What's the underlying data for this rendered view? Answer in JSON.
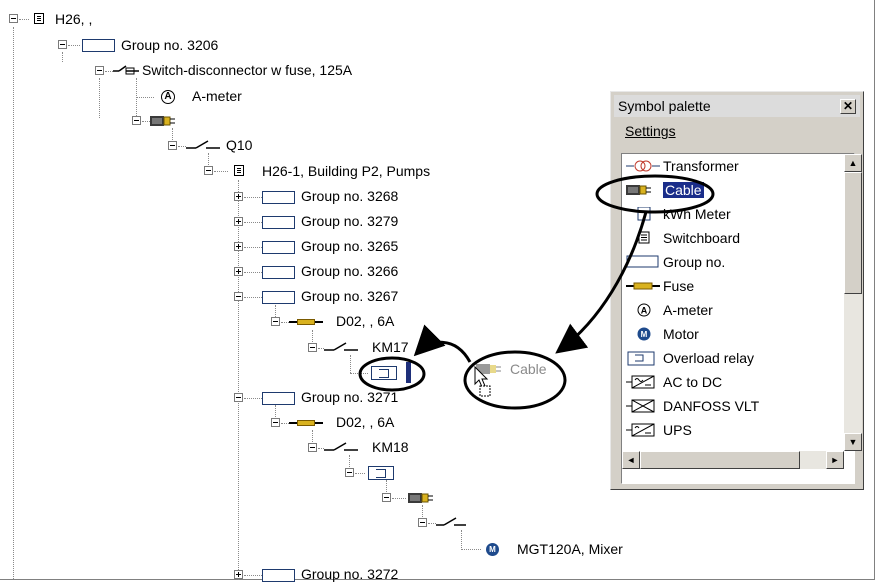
{
  "tree": {
    "root": "H26, ,",
    "group_3206": "Group no. 3206",
    "switch_disconnector": "Switch-disconnector w fuse, 125A",
    "a_meter": "A-meter",
    "q10": "Q10",
    "board_h26_1": "H26-1, Building P2, Pumps",
    "groups_top": [
      "Group no. 3268",
      "Group no. 3279",
      "Group no. 3265",
      "Group no. 3266",
      "Group no. 3267"
    ],
    "d02_a": "D02, , 6A",
    "km17": "KM17",
    "group_3271": "Group no. 3271",
    "d02_b": "D02, , 6A",
    "km18": "KM18",
    "mixer": "MGT120A, Mixer",
    "group_3272": "Group no. 3272"
  },
  "drag": {
    "ghost_label": "Cable"
  },
  "palette": {
    "title": "Symbol palette",
    "close_glyph": "✕",
    "menu_settings": "Settings",
    "items": [
      "Transformer",
      "Cable",
      "kWh Meter",
      "Switchboard",
      "Group no.",
      "Fuse",
      "A-meter",
      "Motor",
      "Overload relay",
      "AC to DC",
      "DANFOSS VLT",
      "UPS"
    ],
    "selected": "Cable",
    "scroll_up": "▲",
    "scroll_down": "▼",
    "scroll_left": "◄",
    "scroll_right": "►"
  },
  "colors": {
    "selection": "#1a2d8a",
    "fuse": "#d9b21f",
    "motor": "#1e4a8c",
    "callout": "#000000"
  }
}
